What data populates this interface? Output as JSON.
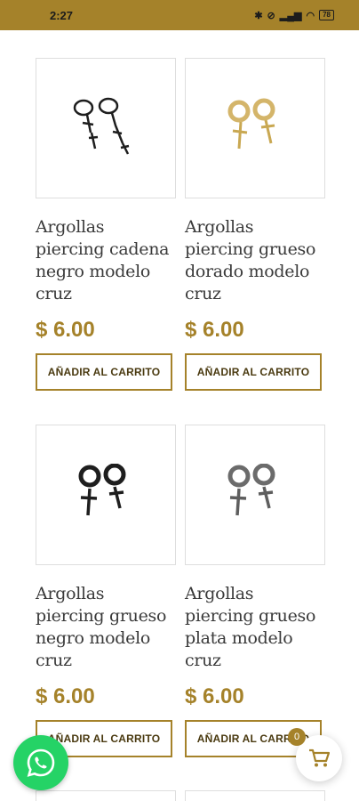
{
  "status_bar": {
    "time": "2:27",
    "battery": "78"
  },
  "products": [
    {
      "title": "Argollas piercing cadena negro modelo cruz",
      "price": "$ 6.00",
      "button": "AÑADIR AL CARRITO",
      "icon": "black-chain-cross-earrings-image"
    },
    {
      "title": "Argollas piercing grueso dorado modelo cruz",
      "price": "$ 6.00",
      "button": "AÑADIR AL CARRITO",
      "icon": "gold-hoop-cross-earrings-image"
    },
    {
      "title": "Argollas piercing grueso negro modelo cruz",
      "price": "$ 6.00",
      "button": "AÑADIR AL CARRITO",
      "icon": "black-hoop-cross-earrings-image"
    },
    {
      "title": "Argollas piercing grueso plata modelo cruz",
      "price": "$ 6.00",
      "button": "AÑADIR AL CARRITO",
      "icon": "silver-hoop-cross-earrings-image"
    }
  ],
  "cart": {
    "count": "0"
  },
  "colors": {
    "accent": "#a5822a",
    "whatsapp": "#25d366",
    "gold_item": "#d4b56a",
    "black_item": "#1e1e1e",
    "silver_item": "#6b6b6b"
  }
}
